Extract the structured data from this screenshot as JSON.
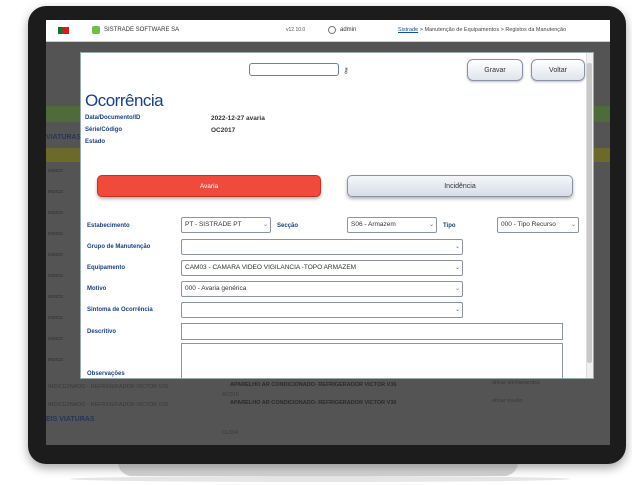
{
  "topbar": {
    "company": "SISTRADE SOFTWARE SA",
    "version": "v12.10.0",
    "user": "admin",
    "breadcrumb_link": "Sistrade",
    "breadcrumb_rest": " > Manutenção de Equipamentos > Registos da Manutenção"
  },
  "background": {
    "section_title": "VIATURAS",
    "row_labels": [
      "INDICE",
      "INDICE",
      "INDICE",
      "INDICE",
      "INDICE",
      "INDICE",
      "INDICE",
      "INDICE",
      "INDICE",
      "INDICE",
      "INDICE"
    ],
    "bottom_code_1": "AC014",
    "bottom_left_1": "INDICE2NADO - REFRIGERADOR VICTOR V36",
    "bottom_desc_1": "APARELHO AR CONDICIONADO- REFRIGERADOR VICTOR V36",
    "bottom_right_1": "afinar alinhamentos",
    "bottom_code_2": "AC015",
    "bottom_left_2": "INDICE2NADO - REFRIGERADOR VICTOR V36",
    "bottom_desc_2": "APARELHO AR CONDICIONADO- REFRIGERADOR VICTOR V36",
    "bottom_right_2": "afinar travão",
    "bottom_code_3": "CL004",
    "viaturas_label": "EIS VIATURAS"
  },
  "modal": {
    "buttons": {
      "save": "Gravar",
      "back": "Voltar"
    },
    "title": "Ocorrência",
    "meta": {
      "doc_label": "Data/Documento/ID",
      "doc_value": "2022-12-27   avaria",
      "serie_label": "Série/Código",
      "serie_value": "OC2017",
      "estado_label": "Estado"
    },
    "tabs": {
      "avaria": "Avaria",
      "incidencia": "Incidência"
    },
    "fields": {
      "estabelecimento_label": "Estabecimento",
      "estabelecimento_value": "PT - SISTRADE PT",
      "seccao_label": "Secção",
      "seccao_value": "S06 - Armazem",
      "tipo_label": "Tipo",
      "tipo_value": "000 - Tipo Recurso",
      "grupo_label": "Grupo de Manutenção",
      "grupo_value": "",
      "equipamento_label": "Equipamento",
      "equipamento_value": "CAM03 - CAMARA VIDEO VIGILANCIA -TOPO ARMAZEM",
      "motivo_label": "Motivo",
      "motivo_value": "000 - Avaria genérica",
      "sintoma_label": "Sintoma de Ocorrência",
      "sintoma_value": "",
      "descritivo_label": "Descritivo",
      "observacoes_label": "Observações"
    }
  }
}
